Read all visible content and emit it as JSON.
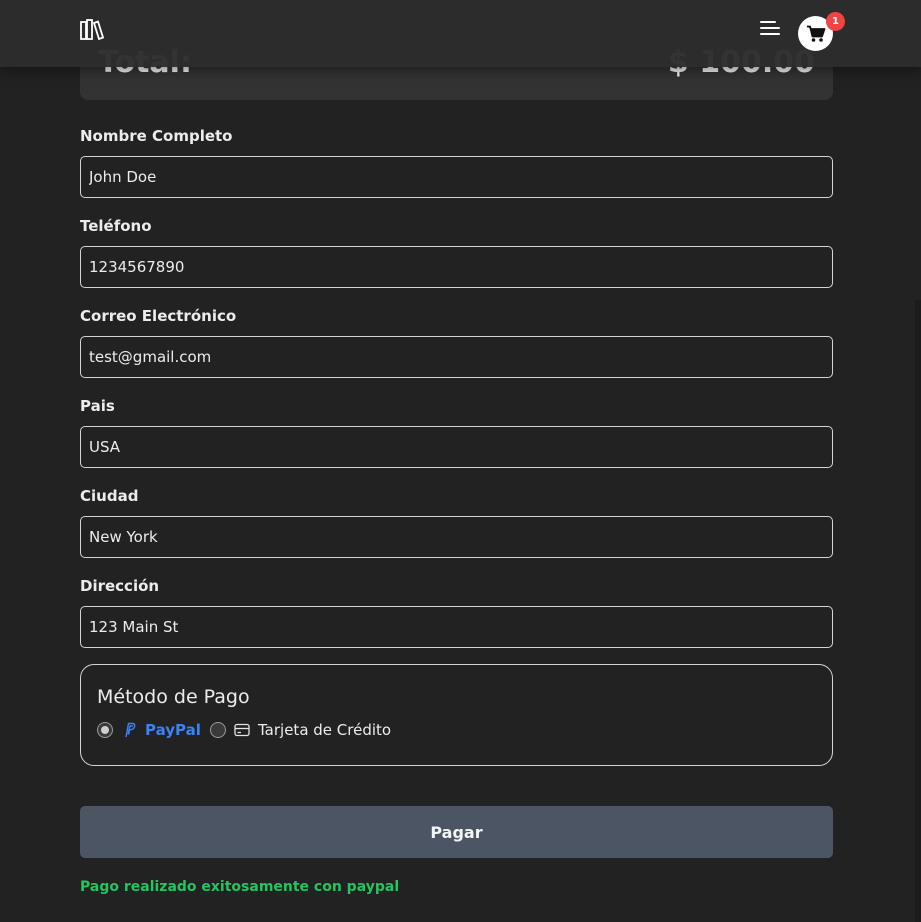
{
  "summary": {
    "total_label": "Total:",
    "total_value": "$ 100.00"
  },
  "navbar": {
    "logo_icon": "books-icon",
    "menu_icon": "hamburger-menu-icon",
    "cart_icon": "shopping-cart-icon",
    "cart_count": "1"
  },
  "form": {
    "fields": [
      {
        "label": "Nombre Completo",
        "value": "John Doe"
      },
      {
        "label": "Teléfono",
        "value": "1234567890"
      },
      {
        "label": "Correo Electrónico",
        "value": "test@gmail.com"
      },
      {
        "label": "Pais",
        "value": "USA"
      },
      {
        "label": "Ciudad",
        "value": "New York"
      },
      {
        "label": "Dirección",
        "value": "123 Main St"
      }
    ]
  },
  "payment": {
    "title": "Método de Pago",
    "options": [
      {
        "label": "PayPal",
        "icon": "paypal-icon",
        "selected": true
      },
      {
        "label": "Tarjeta de Crédito",
        "icon": "credit-card-icon",
        "selected": false
      }
    ]
  },
  "actions": {
    "pay_label": "Pagar"
  },
  "status": {
    "message": "Pago realizado exitosamente con paypal"
  },
  "colors": {
    "background": "#222222",
    "paypal_accent": "#3b82f6",
    "success": "#22c55e",
    "badge": "#ef4444",
    "button": "#4b5563"
  }
}
